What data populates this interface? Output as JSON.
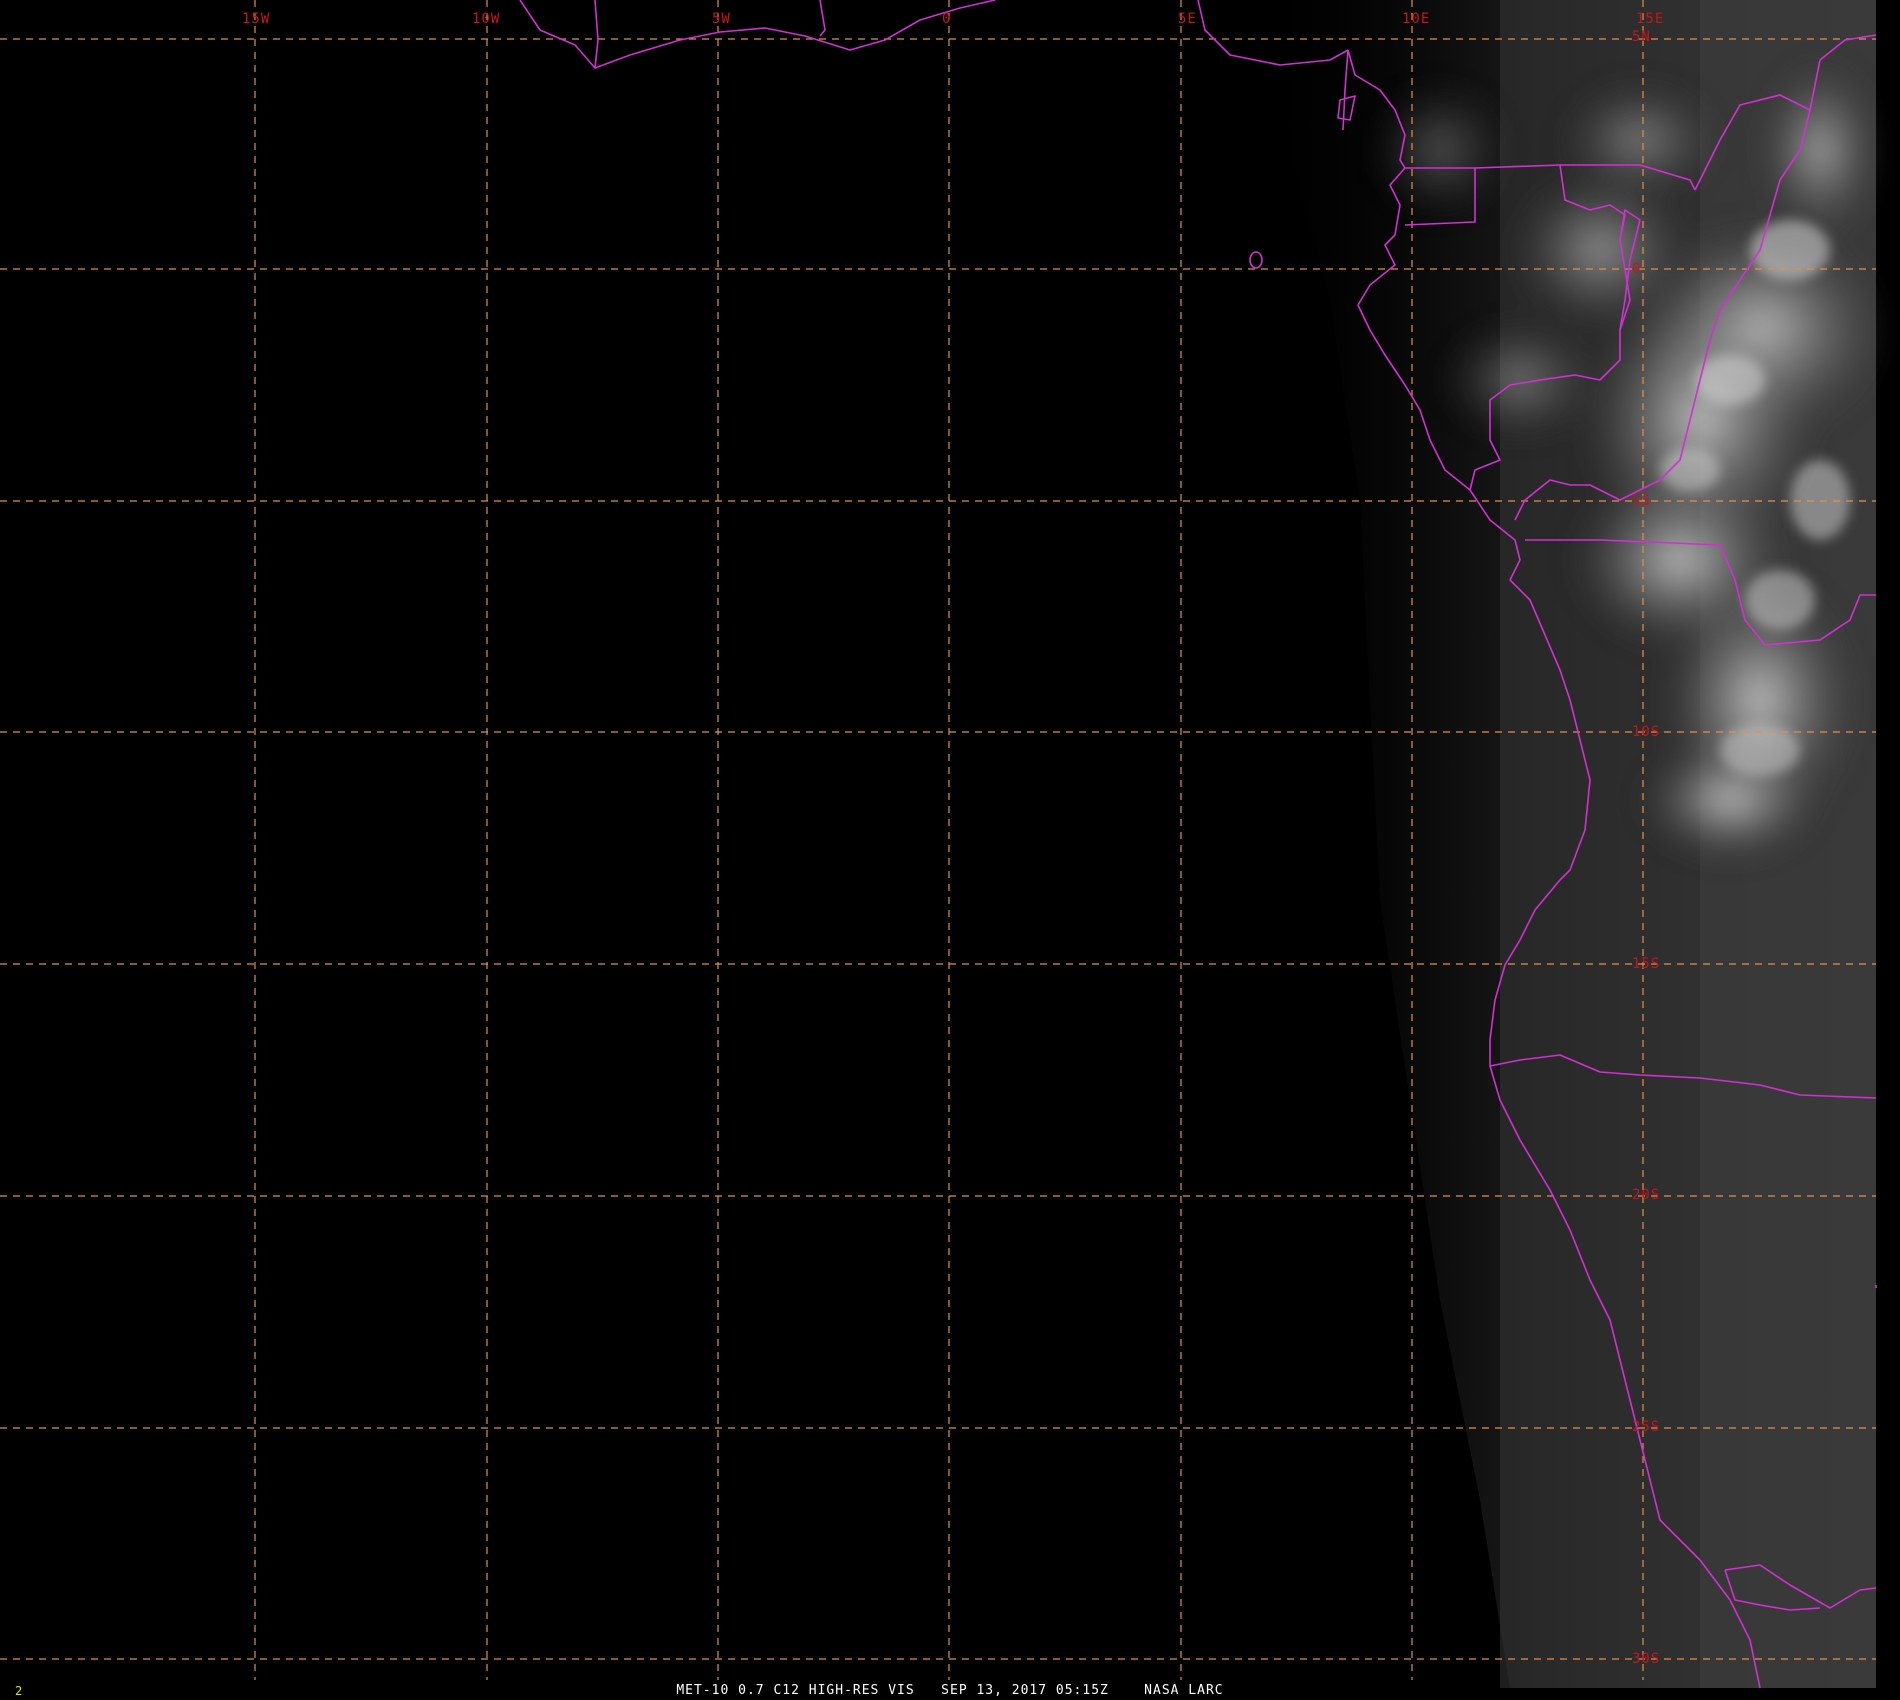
{
  "satellite_image": {
    "caption": "MET-10 0.7 C12 HIGH-RES VIS   SEP 13, 2017 05:15Z    NASA LARC",
    "frame_number": "2",
    "colors": {
      "background": "#000000",
      "grid_line": "#e0914a",
      "grid_label": "#c8141e",
      "border_line": "#d230d2",
      "caption_text": "#ffffff",
      "frame_number_text": "#e6e600"
    },
    "longitude_labels": [
      "15W",
      "10W",
      "5W",
      "0",
      "5E",
      "10E",
      "15E"
    ],
    "latitude_labels": [
      "5N",
      "0",
      "5S",
      "10S",
      "15S",
      "20S",
      "25S",
      "30S"
    ]
  }
}
